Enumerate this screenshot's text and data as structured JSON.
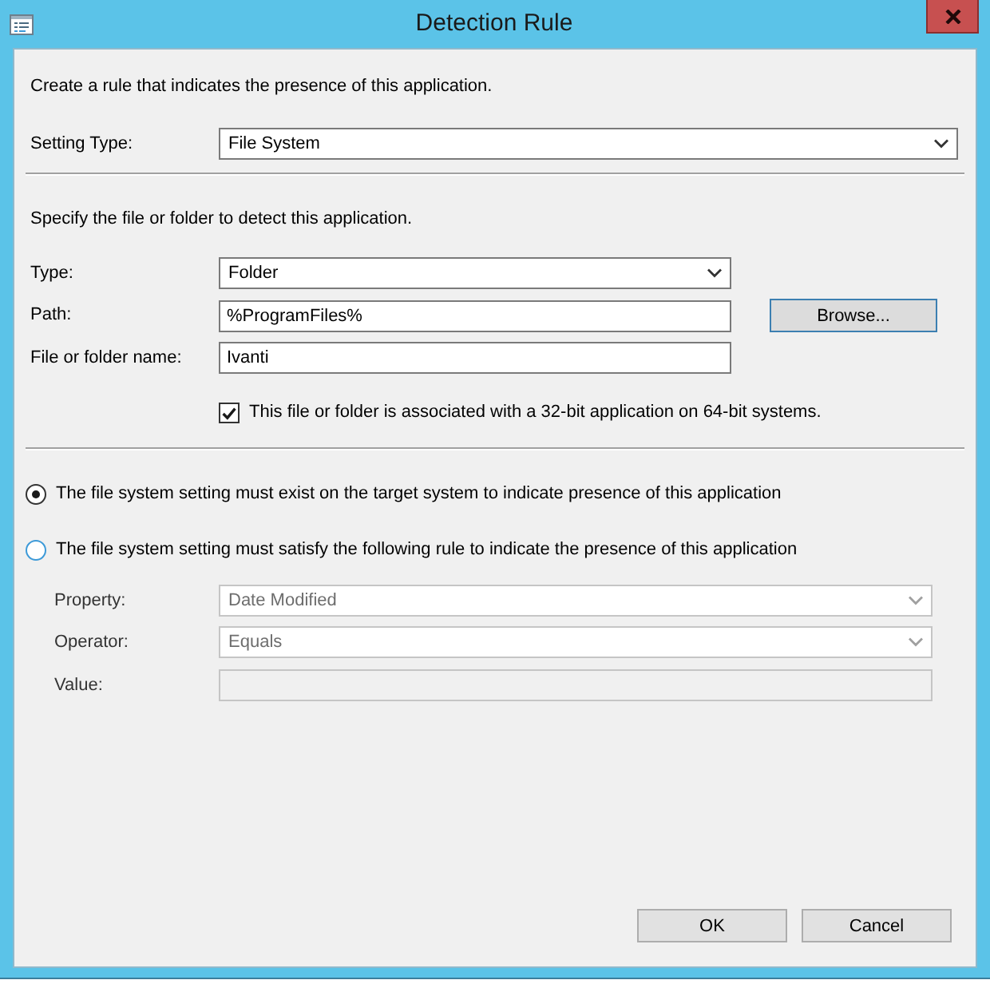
{
  "window": {
    "title": "Detection Rule"
  },
  "intro": "Create a rule that indicates the presence of this application.",
  "setting_type": {
    "kind": "dropdown",
    "label": "Setting Type:",
    "value": "File System",
    "disabled": false
  },
  "file_section": {
    "heading": "Specify the file or folder to detect this application.",
    "fields": [
      {
        "kind": "dropdown",
        "label": "Type:",
        "value": "Folder",
        "disabled": false
      },
      {
        "kind": "text",
        "label": "Path:",
        "value": "%ProgramFiles%",
        "disabled": false,
        "button": {
          "label": "Browse...",
          "highlighted": true
        }
      },
      {
        "kind": "text",
        "label": "File or folder name:",
        "value": "Ivanti",
        "disabled": false
      }
    ],
    "checkbox": {
      "label": "This file or folder is associated with a 32-bit application on 64-bit systems.",
      "checked": true
    }
  },
  "options": [
    {
      "label": "The file system setting must exist on the target system to indicate presence of this application",
      "selected": true
    },
    {
      "label": "The file system setting must satisfy the following rule to indicate the presence of this application",
      "selected": false
    }
  ],
  "rule_fields": [
    {
      "kind": "dropdown",
      "label": "Property:",
      "value": "Date Modified",
      "disabled": true
    },
    {
      "kind": "dropdown",
      "label": "Operator:",
      "value": "Equals",
      "disabled": true
    },
    {
      "kind": "text",
      "label": "Value:",
      "disabled": true
    }
  ],
  "buttons": [
    {
      "label": "OK",
      "highlighted": false
    },
    {
      "label": "Cancel",
      "highlighted": false
    }
  ]
}
